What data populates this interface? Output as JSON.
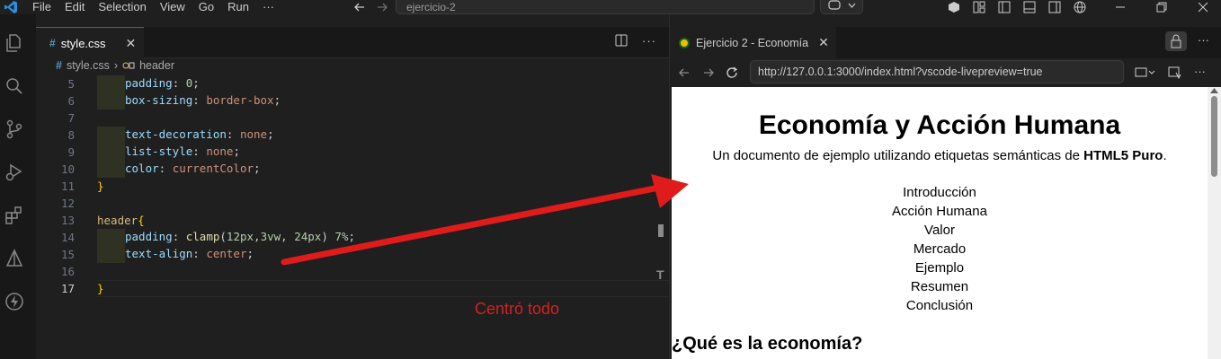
{
  "menu": [
    "File",
    "Edit",
    "Selection",
    "View",
    "Go",
    "Run",
    "···"
  ],
  "command_center": "ejercicio-2",
  "editor": {
    "tab_label": "style.css",
    "breadcrumb": [
      "style.css",
      "header"
    ]
  },
  "code_lines": [
    {
      "n": "5",
      "indent": true,
      "parts": [
        [
          "prop",
          "padding"
        ],
        [
          "plain",
          ": "
        ],
        [
          "num",
          "0"
        ],
        [
          "plain",
          ";"
        ]
      ]
    },
    {
      "n": "6",
      "indent": true,
      "parts": [
        [
          "prop",
          "box-sizing"
        ],
        [
          "plain",
          ": "
        ],
        [
          "val",
          "border-box"
        ],
        [
          "plain",
          ";"
        ]
      ]
    },
    {
      "n": "7",
      "indent": false,
      "parts": []
    },
    {
      "n": "8",
      "indent": true,
      "parts": [
        [
          "prop",
          "text-decoration"
        ],
        [
          "plain",
          ": "
        ],
        [
          "val",
          "none"
        ],
        [
          "plain",
          ";"
        ]
      ]
    },
    {
      "n": "9",
      "indent": true,
      "parts": [
        [
          "prop",
          "list-style"
        ],
        [
          "plain",
          ": "
        ],
        [
          "val",
          "none"
        ],
        [
          "plain",
          ";"
        ]
      ]
    },
    {
      "n": "10",
      "indent": true,
      "parts": [
        [
          "prop",
          "color"
        ],
        [
          "plain",
          ": "
        ],
        [
          "val",
          "currentColor"
        ],
        [
          "plain",
          ";"
        ]
      ]
    },
    {
      "n": "11",
      "indent": false,
      "parts": [
        [
          "brace",
          "}"
        ]
      ]
    },
    {
      "n": "12",
      "indent": false,
      "parts": []
    },
    {
      "n": "13",
      "indent": false,
      "parts": [
        [
          "sel",
          "header"
        ],
        [
          "brace",
          "{"
        ]
      ]
    },
    {
      "n": "14",
      "indent": true,
      "parts": [
        [
          "prop",
          "padding"
        ],
        [
          "plain",
          ": "
        ],
        [
          "fn",
          "clamp"
        ],
        [
          "plain",
          "("
        ],
        [
          "num",
          "12px"
        ],
        [
          "plain",
          ","
        ],
        [
          "num",
          "3vw"
        ],
        [
          "plain",
          ", "
        ],
        [
          "num",
          "24px"
        ],
        [
          "plain",
          ") "
        ],
        [
          "num",
          "7%"
        ],
        [
          "plain",
          ";"
        ]
      ]
    },
    {
      "n": "15",
      "indent": true,
      "parts": [
        [
          "prop",
          "text-align"
        ],
        [
          "plain",
          ": "
        ],
        [
          "val",
          "center"
        ],
        [
          "plain",
          ";"
        ]
      ]
    },
    {
      "n": "16",
      "indent": false,
      "parts": []
    },
    {
      "n": "17",
      "indent": false,
      "parts": [
        [
          "brace",
          "}"
        ]
      ],
      "active": true
    }
  ],
  "annotation": "Centró todo",
  "preview": {
    "tab_title": "Ejercicio 2 - Economía",
    "url": "http://127.0.0.1:3000/index.html?vscode-livepreview=true",
    "page_title": "Economía y Acción Humana",
    "subtitle_prefix": "Un documento de ejemplo utilizando etiquetas semánticas de ",
    "subtitle_bold": "HTML5 Puro",
    "subtitle_suffix": ".",
    "nav_items": [
      "Introducción",
      "Acción Humana",
      "Valor",
      "Mercado",
      "Ejemplo",
      "Resumen",
      "Conclusión"
    ],
    "section_heading": "¿Qué es la economía?"
  },
  "colors": {
    "accent": "#0078d4",
    "annotation": "#d32121"
  }
}
